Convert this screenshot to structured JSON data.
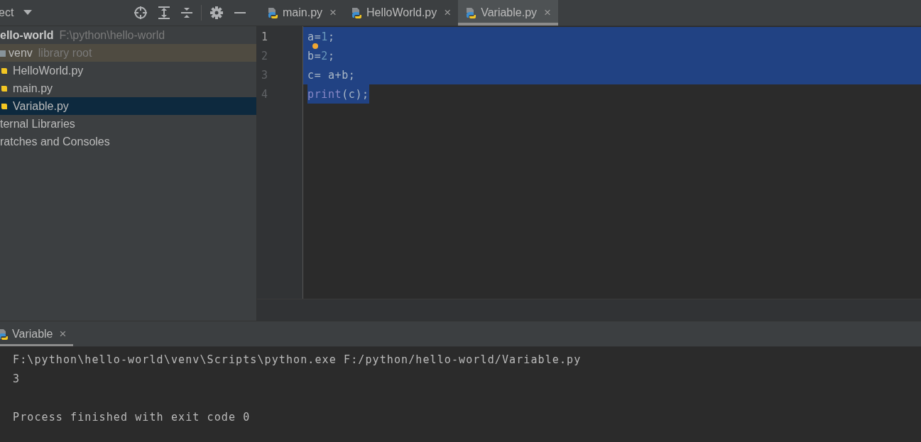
{
  "project_panel": {
    "title": "ect",
    "tree": [
      {
        "name": "ello-world",
        "path": "F:\\python\\hello-world",
        "kind": "root",
        "selected": false,
        "highlighted": false,
        "children": [
          {
            "name": "venv",
            "path": "library root",
            "kind": "folder",
            "selected": false,
            "highlighted": true
          },
          {
            "name": "HelloWorld.py",
            "kind": "python",
            "selected": false,
            "highlighted": false
          },
          {
            "name": "main.py",
            "kind": "python",
            "selected": false,
            "highlighted": false
          },
          {
            "name": "Variable.py",
            "kind": "python",
            "selected": true,
            "highlighted": false
          }
        ]
      },
      {
        "name": "ternal Libraries",
        "kind": "plain",
        "selected": false,
        "highlighted": false
      },
      {
        "name": "ratches and Consoles",
        "kind": "plain",
        "selected": false,
        "highlighted": false
      }
    ]
  },
  "editor_tabs": [
    {
      "label": "main.py",
      "selected": false
    },
    {
      "label": "HelloWorld.py",
      "selected": false
    },
    {
      "label": "Variable.py",
      "selected": true
    }
  ],
  "tab_close": "×",
  "code": [
    {
      "number": "1",
      "current": true,
      "selected": true,
      "selected_to_end": true,
      "tokens": [
        {
          "text": "a=",
          "kind": "plain"
        },
        {
          "text": "1",
          "kind": "number"
        },
        {
          "text": ";",
          "kind": "plain"
        }
      ]
    },
    {
      "number": "2",
      "current": false,
      "selected": true,
      "selected_to_end": true,
      "bulb": true,
      "tokens": [
        {
          "text": "b=",
          "kind": "plain"
        },
        {
          "text": "2",
          "kind": "number"
        },
        {
          "text": ";",
          "kind": "plain"
        }
      ]
    },
    {
      "number": "3",
      "current": false,
      "selected": true,
      "selected_to_end": true,
      "tokens": [
        {
          "text": "c= a+b;",
          "kind": "plain"
        }
      ]
    },
    {
      "number": "4",
      "current": false,
      "selected": true,
      "selected_to_end": false,
      "tokens": [
        {
          "text": "print",
          "kind": "builtin"
        },
        {
          "text": "(c);",
          "kind": "plain"
        }
      ]
    }
  ],
  "run_panel": {
    "tab": {
      "label": "Variable",
      "selected": true
    },
    "output": [
      {
        "kind": "text",
        "text": "F:\\python\\hello-world\\venv\\Scripts\\python.exe F:/python/hello-world/Variable.py"
      },
      {
        "kind": "text",
        "text": "3"
      },
      {
        "kind": "blank"
      },
      {
        "kind": "text",
        "text": "Process finished with exit code 0"
      }
    ]
  }
}
